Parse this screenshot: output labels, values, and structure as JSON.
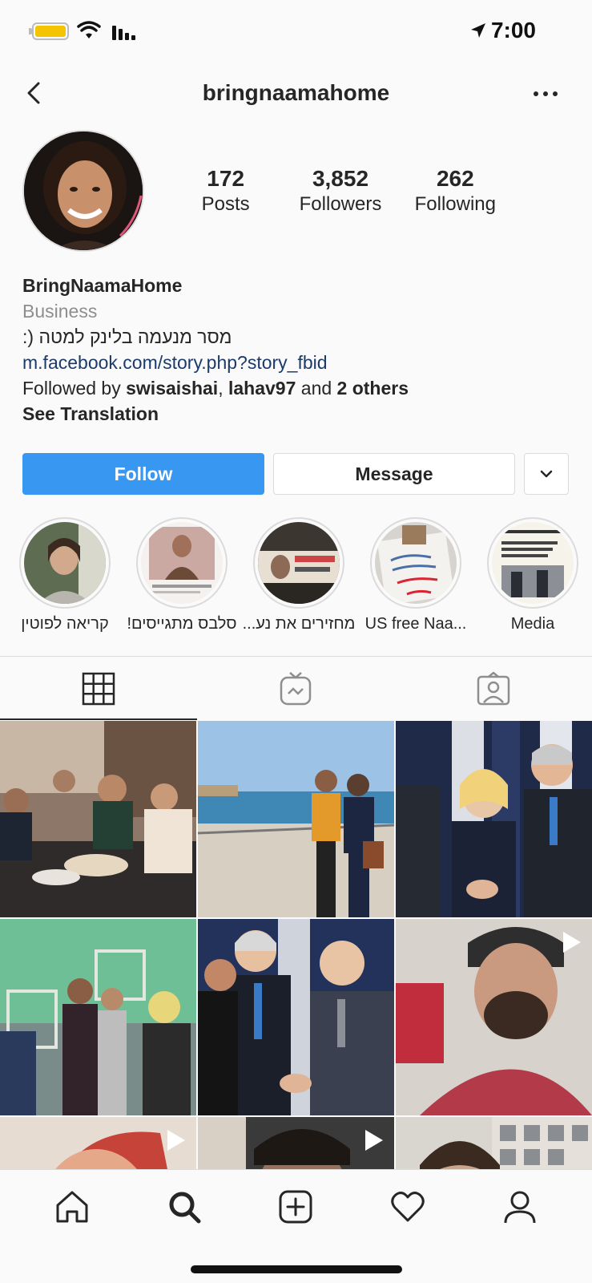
{
  "status_bar": {
    "time": "7:00"
  },
  "header": {
    "username": "bringnaamahome"
  },
  "profile": {
    "stats": [
      {
        "value": "172",
        "label": "Posts"
      },
      {
        "value": "3,852",
        "label": "Followers"
      },
      {
        "value": "262",
        "label": "Following"
      }
    ],
    "name": "BringNaamaHome",
    "category": "Business",
    "bio_text": "מסר מנעמה בלינק למטה (:",
    "link": "m.facebook.com/story.php?story_fbid",
    "followed_by_prefix": "Followed by ",
    "followed_by_user1": "swisaishai",
    "followed_by_sep": ", ",
    "followed_by_user2": "lahav97",
    "followed_by_and": " and ",
    "followed_by_others": "2 others",
    "see_translation": "See Translation"
  },
  "buttons": {
    "follow": "Follow",
    "message": "Message"
  },
  "highlights": [
    {
      "label": "קריאה לפוטין"
    },
    {
      "label": "סלבס מתגייסים!"
    },
    {
      "label": "מחזירים את נע..."
    },
    {
      "label": "US free Naa..."
    },
    {
      "label": "Media"
    }
  ],
  "colors": {
    "accent": "#3897f0",
    "link": "#1c3b6b",
    "battery": "#f5c400"
  },
  "icons": [
    "back-arrow-icon",
    "more-icon",
    "grid-icon",
    "igtv-icon",
    "tagged-icon",
    "play-icon",
    "home-icon",
    "search-icon",
    "add-icon",
    "heart-icon",
    "profile-icon"
  ]
}
